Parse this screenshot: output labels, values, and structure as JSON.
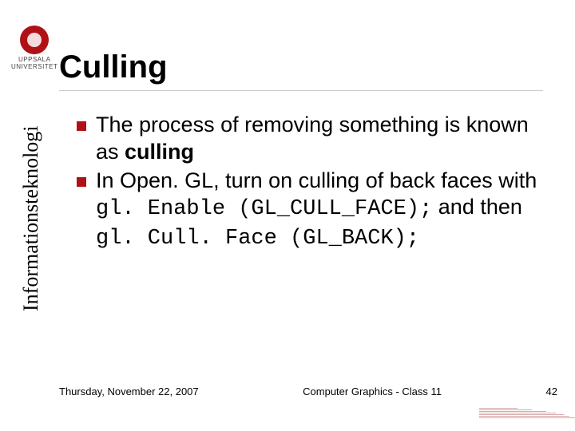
{
  "logo": {
    "line1": "UPPSALA",
    "line2": "UNIVERSITET"
  },
  "title": "Culling",
  "sidebar_label": "Informationsteknologi",
  "bullets": [
    {
      "pre": "The process of removing something is known as ",
      "bold": "culling",
      "post": ""
    },
    {
      "pre": "In Open. GL, turn on culling of back faces with ",
      "code1": "gl. Enable (GL_CULL_FACE);",
      "mid": " and then ",
      "code2": "gl. Cull. Face (GL_BACK);",
      "post": ""
    }
  ],
  "footer": {
    "date": "Thursday, November 22, 2007",
    "title": "Computer Graphics - Class 11",
    "page": "42"
  }
}
